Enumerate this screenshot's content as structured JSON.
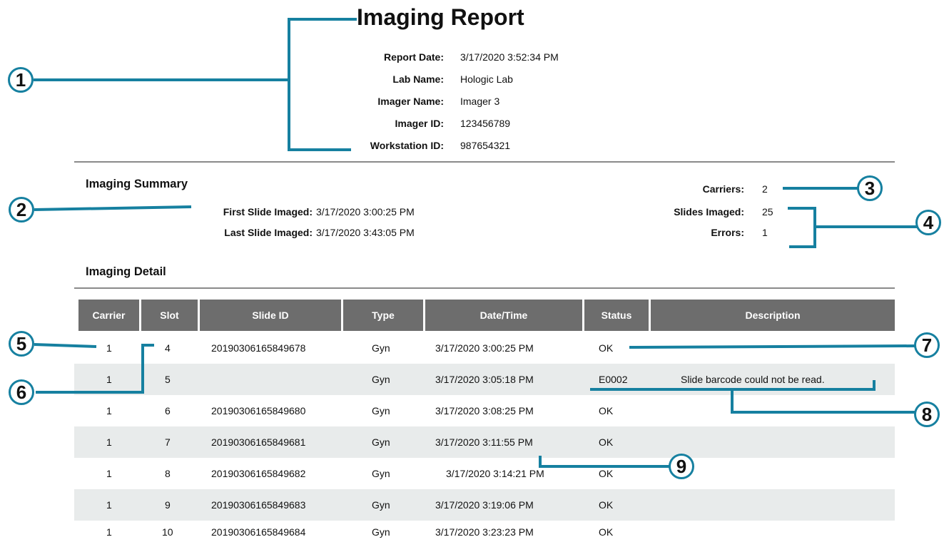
{
  "header": {
    "title": "Imaging Report",
    "fields": [
      {
        "label": "Report Date:",
        "value": "3/17/2020 3:52:34 PM"
      },
      {
        "label": "Lab Name:",
        "value": "Hologic Lab"
      },
      {
        "label": "Imager Name:",
        "value": "Imager 3"
      },
      {
        "label": "Imager ID:",
        "value": "123456789"
      },
      {
        "label": "Workstation ID:",
        "value": "987654321"
      }
    ]
  },
  "summary": {
    "heading": "Imaging Summary",
    "first_label": "First Slide Imaged:",
    "first_value": "3/17/2020 3:00:25 PM",
    "last_label": "Last Slide Imaged:",
    "last_value": "3/17/2020 3:43:05 PM",
    "carriers_label": "Carriers:",
    "carriers_value": "2",
    "slides_label": "Slides Imaged:",
    "slides_value": "25",
    "errors_label": "Errors:",
    "errors_value": "1"
  },
  "detail": {
    "heading": "Imaging Detail",
    "columns": [
      "Carrier",
      "Slot",
      "Slide ID",
      "Type",
      "Date/Time",
      "Status",
      "Description"
    ],
    "rows": [
      {
        "carrier": "1",
        "slot": "4",
        "slide_id": "20190306165849678",
        "type": "Gyn",
        "datetime": "3/17/2020 3:00:25 PM",
        "status": "OK",
        "description": ""
      },
      {
        "carrier": "1",
        "slot": "5",
        "slide_id": "",
        "type": "Gyn",
        "datetime": "3/17/2020 3:05:18 PM",
        "status": "E0002",
        "description": "Slide barcode could not be read."
      },
      {
        "carrier": "1",
        "slot": "6",
        "slide_id": "20190306165849680",
        "type": "Gyn",
        "datetime": "3/17/2020 3:08:25 PM",
        "status": "OK",
        "description": ""
      },
      {
        "carrier": "1",
        "slot": "7",
        "slide_id": "20190306165849681",
        "type": "Gyn",
        "datetime": "3/17/2020 3:11:55 PM",
        "status": "OK",
        "description": ""
      },
      {
        "carrier": "1",
        "slot": "8",
        "slide_id": "20190306165849682",
        "type": "Gyn",
        "datetime": "3/17/2020 3:14:21 PM",
        "status": "OK",
        "description": ""
      },
      {
        "carrier": "1",
        "slot": "9",
        "slide_id": "20190306165849683",
        "type": "Gyn",
        "datetime": "3/17/2020 3:19:06 PM",
        "status": "OK",
        "description": ""
      },
      {
        "carrier": "1",
        "slot": "10",
        "slide_id": "20190306165849684",
        "type": "Gyn",
        "datetime": "3/17/2020 3:23:23 PM",
        "status": "OK",
        "description": ""
      }
    ]
  },
  "callouts": [
    "1",
    "2",
    "3",
    "4",
    "5",
    "6",
    "7",
    "8",
    "9"
  ],
  "colors": {
    "callout": "#1680a0",
    "table_header": "#6d6d6d",
    "alt_row": "#e8ebeb",
    "rule": "#8a8a8a"
  }
}
